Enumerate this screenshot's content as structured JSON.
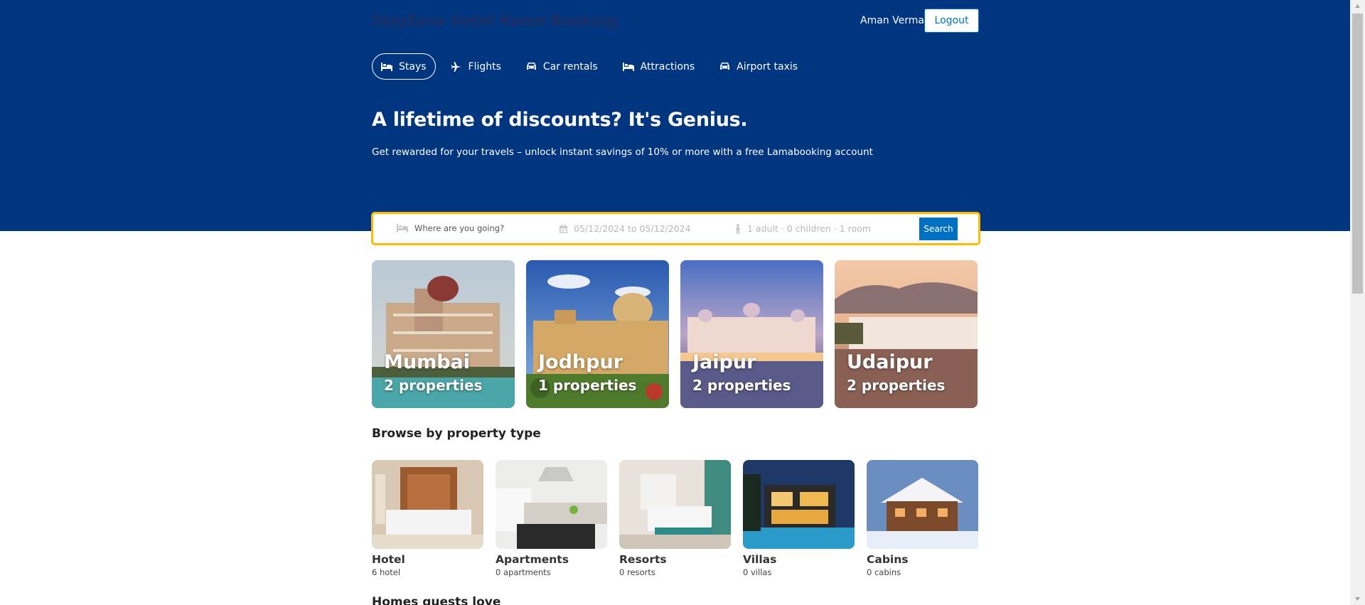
{
  "header": {
    "brand": "StayEase Hotel Room Booking",
    "user_name": "Aman Verma",
    "logout_label": "Logout"
  },
  "nav": {
    "items": [
      {
        "label": "Stays",
        "icon": "bed-icon",
        "active": true
      },
      {
        "label": "Flights",
        "icon": "plane-icon"
      },
      {
        "label": "Car rentals",
        "icon": "car-icon"
      },
      {
        "label": "Attractions",
        "icon": "bed-icon"
      },
      {
        "label": "Airport taxis",
        "icon": "taxi-icon"
      }
    ]
  },
  "hero": {
    "headline": "A lifetime of discounts? It's Genius.",
    "subline": "Get rewarded for your travels – unlock instant savings of 10% or more with a free Lamabooking account"
  },
  "search": {
    "destination_placeholder": "Where are you going?",
    "dates": "05/12/2024 to 05/12/2024",
    "options": "1 adult · 0 children · 1 room",
    "button_label": "Search"
  },
  "featured": [
    {
      "name": "Mumbai",
      "count": "2 properties"
    },
    {
      "name": "Jodhpur",
      "count": "1 properties"
    },
    {
      "name": "Jaipur",
      "count": "2 properties"
    },
    {
      "name": "Udaipur",
      "count": "2 properties"
    }
  ],
  "property_section": {
    "title": "Browse by property type",
    "items": [
      {
        "label": "Hotel",
        "sub": "6 hotel"
      },
      {
        "label": "Apartments",
        "sub": "0 apartments"
      },
      {
        "label": "Resorts",
        "sub": "0 resorts"
      },
      {
        "label": "Villas",
        "sub": "0 villas"
      },
      {
        "label": "Cabins",
        "sub": "0 cabins"
      }
    ]
  },
  "homes_section": {
    "title": "Homes guests love"
  },
  "colors": {
    "header_bg": "#003580",
    "accent": "#0071c2",
    "search_border": "#febb02"
  }
}
